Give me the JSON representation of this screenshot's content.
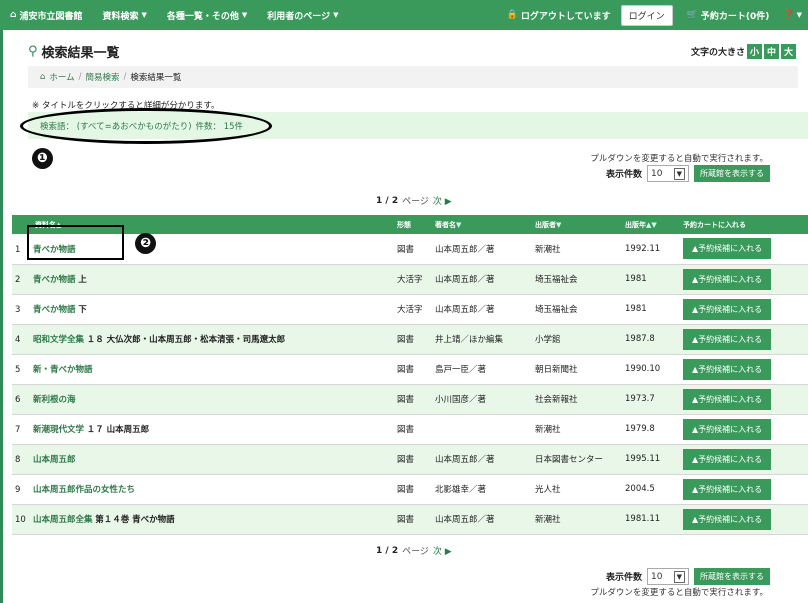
{
  "nav": {
    "brand": "浦安市立図書館",
    "items": [
      "資料検索",
      "各種一覧・その他",
      "利用者のページ"
    ],
    "logout_status": "ログアウトしています",
    "login_label": "ログイン",
    "cart_label": "予約カート(0件)"
  },
  "page": {
    "title": "検索結果一覧",
    "fontsize_label": "文字の大きさ",
    "fontsize_options": [
      "小",
      "中",
      "大"
    ]
  },
  "breadcrumb": [
    "ホーム",
    "簡易検索",
    "検索結果一覧"
  ],
  "hint": "※ タイトルをクリックすると詳細が分かります。",
  "search": {
    "terms": "検索語： (すべて=あおべかものがたり)",
    "count": "件数： 15件"
  },
  "markers": [
    "❶",
    "❷"
  ],
  "controls": {
    "auto_note": "プルダウンを変更すると自動で実行されます。",
    "display_count_label": "表示件数",
    "display_count_value": "10",
    "holdings_button": "所蔵館を表示する"
  },
  "pager": {
    "current": "1 / 2",
    "page_label": "ページ",
    "next_label": "次"
  },
  "table": {
    "headers": [
      "資料名",
      "形態",
      "著者名",
      "出版者",
      "出版年",
      "予約カートに入れる"
    ],
    "reserve_label": "▲予約候補に入れる",
    "rows": [
      {
        "no": "1",
        "title": "青べか物語",
        "sub": "",
        "form": "図書",
        "author": "山本周五郎／著",
        "publisher": "新潮社",
        "year": "1992.11"
      },
      {
        "no": "2",
        "title": "青べか物語",
        "sub": "上",
        "form": "大活字",
        "author": "山本周五郎／著",
        "publisher": "埼玉福祉会",
        "year": "1981"
      },
      {
        "no": "3",
        "title": "青べか物語",
        "sub": "下",
        "form": "大活字",
        "author": "山本周五郎／著",
        "publisher": "埼玉福祉会",
        "year": "1981"
      },
      {
        "no": "4",
        "title": "昭和文学全集",
        "sub": "１８ 大仏次郎・山本周五郎・松本清張・司馬遼太郎",
        "form": "図書",
        "author": "井上靖／ほか編集",
        "publisher": "小学館",
        "year": "1987.8"
      },
      {
        "no": "5",
        "title": "新・青べか物語",
        "sub": "",
        "form": "図書",
        "author": "島戸一臣／著",
        "publisher": "朝日新聞社",
        "year": "1990.10"
      },
      {
        "no": "6",
        "title": "新利根の海",
        "sub": "",
        "form": "図書",
        "author": "小川国彦／著",
        "publisher": "社会新報社",
        "year": "1973.7"
      },
      {
        "no": "7",
        "title": "新潮現代文学",
        "sub": "１７ 山本周五郎",
        "form": "図書",
        "author": "",
        "publisher": "新潮社",
        "year": "1979.8"
      },
      {
        "no": "8",
        "title": "山本周五郎",
        "sub": "",
        "form": "図書",
        "author": "山本周五郎／著",
        "publisher": "日本図書センター",
        "year": "1995.11"
      },
      {
        "no": "9",
        "title": "山本周五郎作品の女性たち",
        "sub": "",
        "form": "図書",
        "author": "北影雄幸／著",
        "publisher": "光人社",
        "year": "2004.5"
      },
      {
        "no": "10",
        "title": "山本周五郎全集",
        "sub": "第１４巻 青べか物語",
        "form": "図書",
        "author": "山本周五郎／著",
        "publisher": "新潮社",
        "year": "1981.11"
      }
    ]
  },
  "colors": {
    "accent": "#3a9a5c",
    "row_alt": "#e8f7e8",
    "search_bg": "#e4f7e4"
  }
}
